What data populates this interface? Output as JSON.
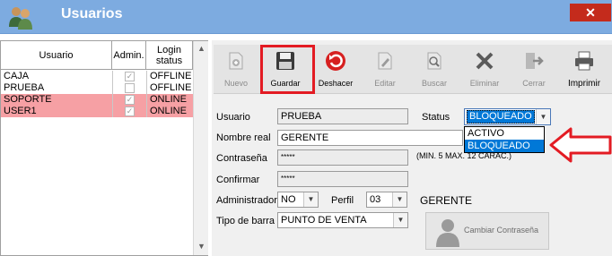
{
  "window": {
    "title": "Usuarios",
    "close_icon": "close-icon"
  },
  "grid": {
    "headers": [
      "Usuario",
      "Admin.",
      "Login\nstatus"
    ],
    "rows": [
      {
        "user": "CAJA",
        "admin": true,
        "status": "OFFLINE",
        "highlight": false
      },
      {
        "user": "PRUEBA",
        "admin": false,
        "status": "OFFLINE",
        "highlight": false
      },
      {
        "user": "SOPORTE",
        "admin": true,
        "status": "ONLINE",
        "highlight": true
      },
      {
        "user": "USER1",
        "admin": true,
        "status": "ONLINE",
        "highlight": true
      }
    ]
  },
  "toolbar": {
    "nuevo": "Nuevo",
    "guardar": "Guardar",
    "deshacer": "Deshacer",
    "editar": "Editar",
    "buscar": "Buscar",
    "eliminar": "Eliminar",
    "cerrar": "Cerrar",
    "imprimir": "Imprimir"
  },
  "form": {
    "usuario_label": "Usuario",
    "usuario_value": "PRUEBA",
    "status_label": "Status",
    "status_value": "BLOQUEADO",
    "status_options": [
      "ACTIVO",
      "BLOQUEADO"
    ],
    "nombre_label": "Nombre real",
    "nombre_value": "GERENTE",
    "contrasena_label": "Contraseña",
    "contrasena_value": "*****",
    "contrasena_hint": "(MIN. 5  MAX. 12 CARAC.)",
    "confirmar_label": "Confirmar",
    "confirmar_value": "*****",
    "admin_label": "Administrador",
    "admin_value": "NO",
    "perfil_label": "Perfil",
    "perfil_value": "03",
    "perfil_name": "GERENTE",
    "tipo_label": "Tipo de barra",
    "tipo_value": "PUNTO DE VENTA",
    "cambiar_label": "Cambiar Contraseña"
  },
  "colors": {
    "titlebar": "#7dabe0",
    "highlight_row": "#f6a0a4",
    "accent_red": "#e31b23",
    "selection_blue": "#0078d7"
  }
}
